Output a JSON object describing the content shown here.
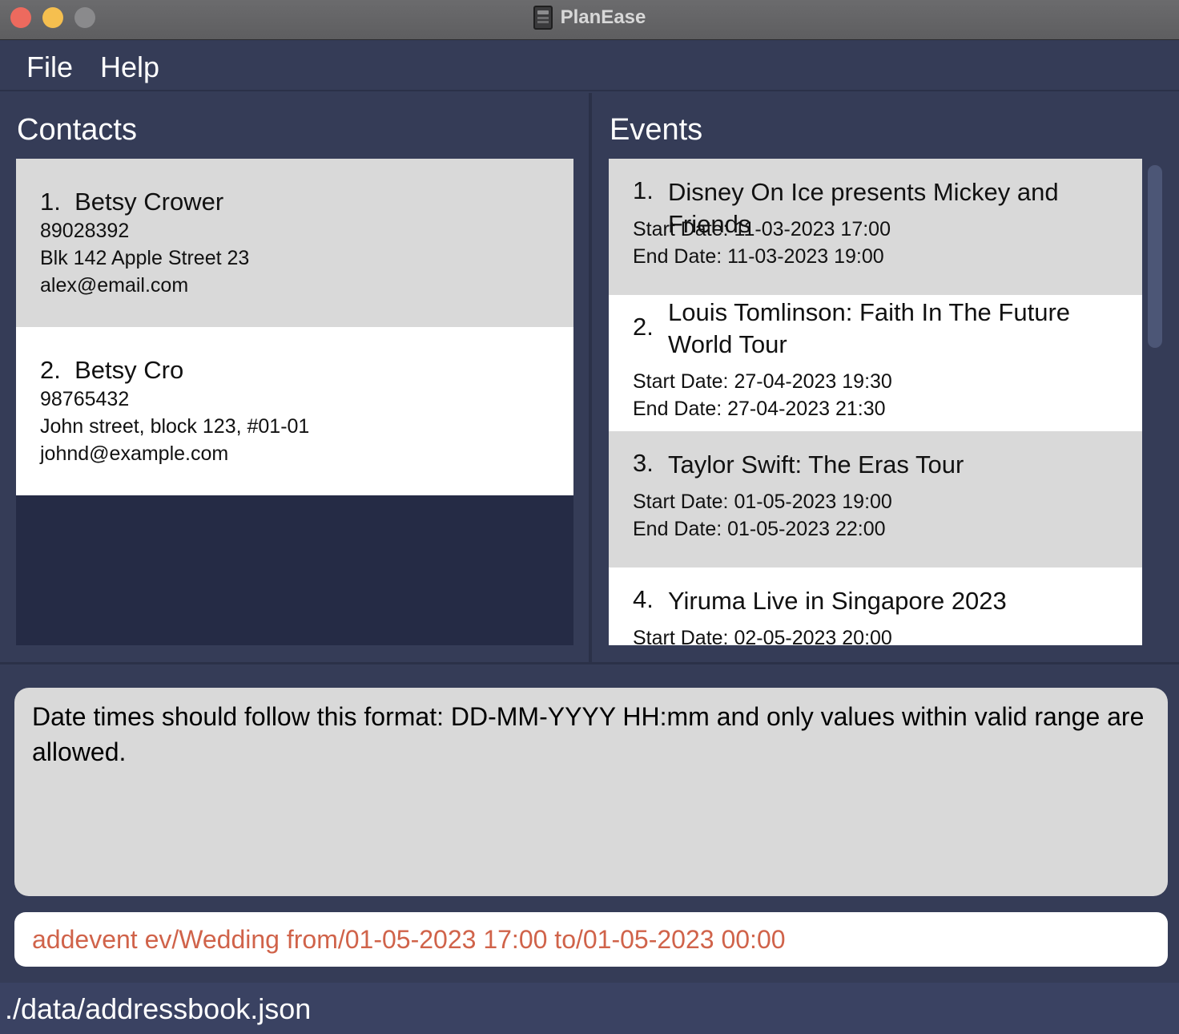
{
  "window": {
    "title": "PlanEase",
    "app_icon": "notebook-icon"
  },
  "menu": {
    "file": "File",
    "help": "Help"
  },
  "contacts": {
    "title": "Contacts",
    "items": [
      {
        "index": "1.",
        "name": "Betsy Crower",
        "phone": "89028392",
        "address": "Blk 142 Apple Street 23",
        "email": "alex@email.com"
      },
      {
        "index": "2.",
        "name": "Betsy Cro",
        "phone": "98765432",
        "address": "John street, block 123, #01-01",
        "email": "johnd@example.com"
      }
    ]
  },
  "events": {
    "title": "Events",
    "items": [
      {
        "index": "1.",
        "name": "Disney On Ice presents Mickey and Friends",
        "start": "Start Date: 11-03-2023 17:00",
        "end": "End Date: 11-03-2023 19:00"
      },
      {
        "index": "2.",
        "name": "Louis Tomlinson: Faith In The Future World Tour",
        "start": "Start Date: 27-04-2023 19:30",
        "end": "End Date: 27-04-2023 21:30"
      },
      {
        "index": "3.",
        "name": "Taylor Swift: The Eras Tour",
        "start": "Start Date: 01-05-2023 19:00",
        "end": "End Date: 01-05-2023 22:00"
      },
      {
        "index": "4.",
        "name": "Yiruma Live in Singapore 2023",
        "start": "Start Date: 02-05-2023 20:00"
      }
    ]
  },
  "result": {
    "message": "Date times should follow this format: DD-MM-YYYY HH:mm and only values within valid range are allowed."
  },
  "command": {
    "value": "addevent ev/Wedding from/01-05-2023 17:00 to/01-05-2023 00:00",
    "error_color": "#d0634a"
  },
  "status": {
    "file_path": "./data/addressbook.json"
  }
}
